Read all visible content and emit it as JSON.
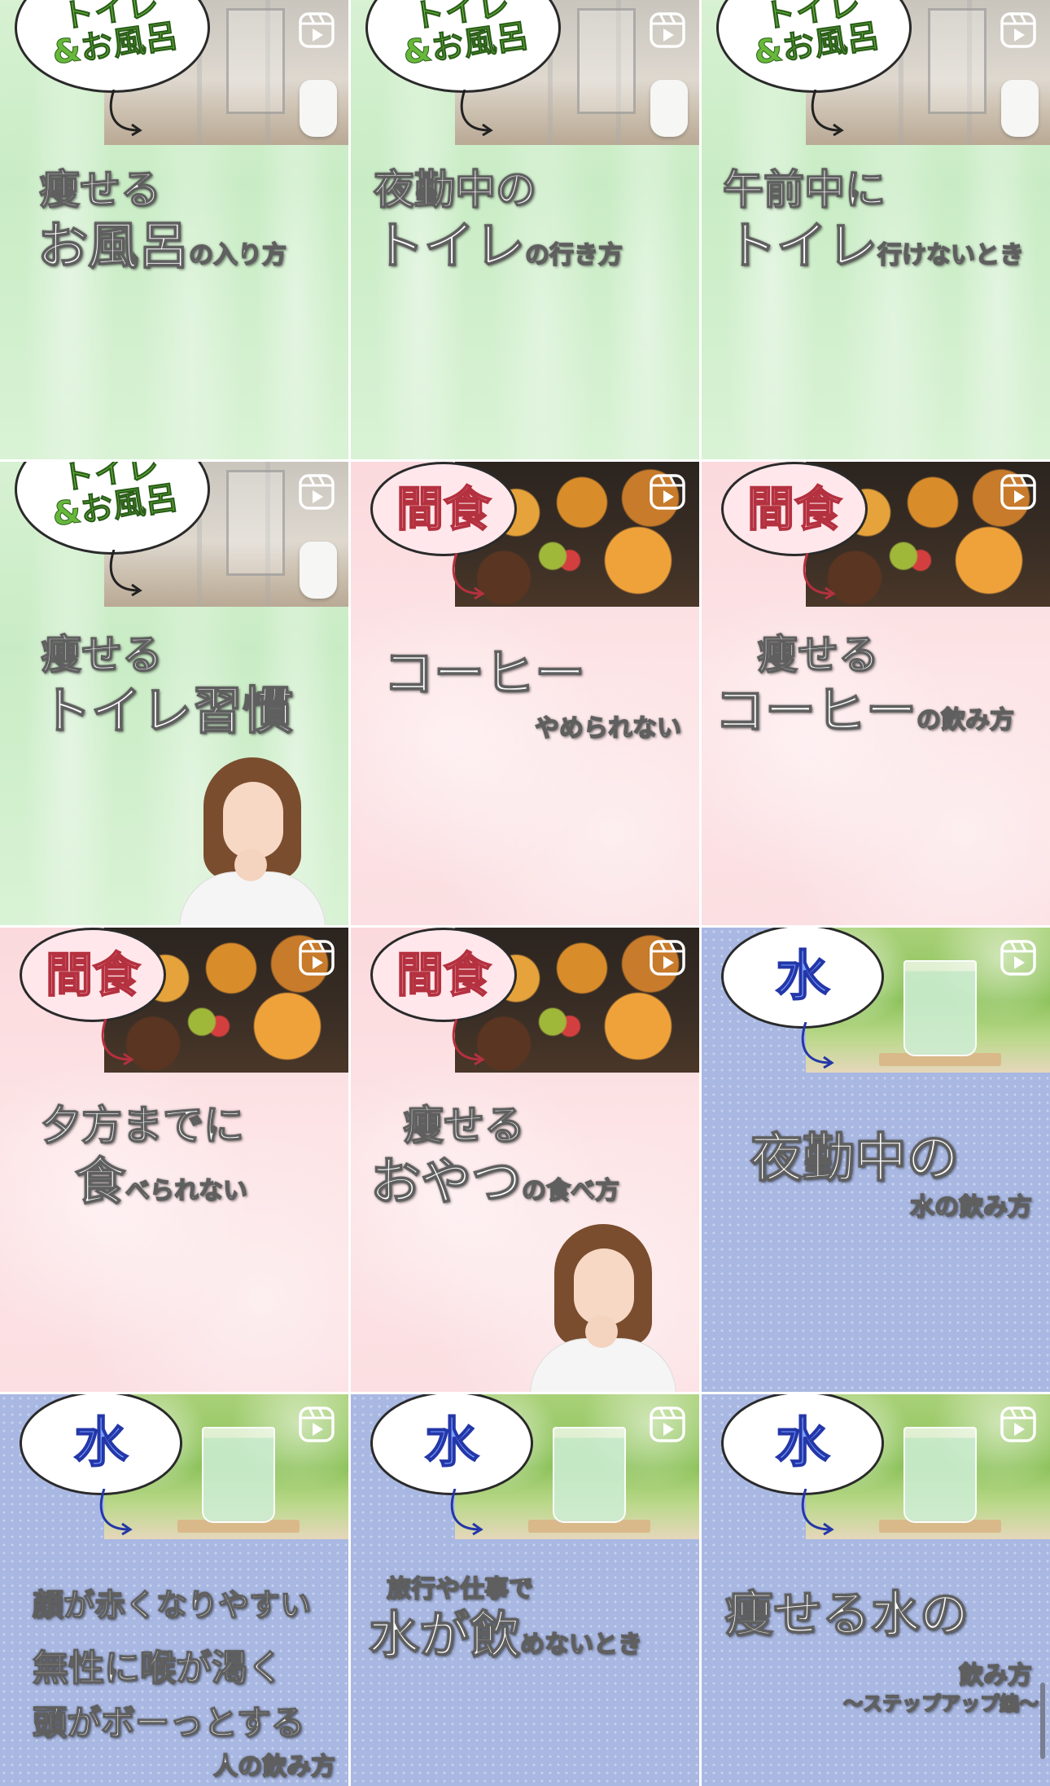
{
  "icons": {
    "reel": "reels-icon"
  },
  "tiles": [
    {
      "theme": "green",
      "badge": "トイレ\n&お風呂",
      "line1": "痩せる",
      "line2": "お風呂",
      "line2_suffix": "の入り方"
    },
    {
      "theme": "green",
      "badge": "トイレ\n&お風呂",
      "line1": "夜勤中の",
      "line2": "トイレ",
      "line2_suffix": "の行き方"
    },
    {
      "theme": "green",
      "badge": "トイレ\n&お風呂",
      "line1": "午前中に",
      "line2": "トイレ",
      "line2_suffix": "行けないとき"
    },
    {
      "theme": "green",
      "badge": "トイレ\n&お風呂",
      "line1": "痩せる",
      "line2": "トイレ習慣",
      "line2_suffix": ""
    },
    {
      "theme": "pink",
      "badge": "間食",
      "line1": "コーヒー",
      "line2": "やめられない",
      "line2_suffix": ""
    },
    {
      "theme": "pink",
      "badge": "間食",
      "line1": "痩せる",
      "line2": "コーヒー",
      "line2_suffix": "の飲み方"
    },
    {
      "theme": "pink",
      "badge": "間食",
      "line1": "夕方までに",
      "line2": "食",
      "line2_suffix": "べられない"
    },
    {
      "theme": "pink",
      "badge": "間食",
      "line1": "痩せる",
      "line2": "おやつ",
      "line2_suffix": "の食べ方"
    },
    {
      "theme": "blue",
      "badge": "水",
      "line1": "夜勤中の",
      "line2": "水の飲み方",
      "line2_suffix": ""
    },
    {
      "theme": "blue",
      "badge": "水",
      "line1": "顔が赤くなりやすい",
      "line2": "無性に喉が渇く",
      "line3": "頭がボーっとする",
      "line4": "人の飲み方"
    },
    {
      "theme": "blue",
      "badge": "水",
      "line1": "旅行や仕事で",
      "line2": "水が飲",
      "line2_suffix": "めないとき"
    },
    {
      "theme": "blue",
      "badge": "水",
      "line1": "痩せる水の",
      "line2": "飲み方",
      "line2_suffix": "〜ステップアップ編〜"
    }
  ]
}
